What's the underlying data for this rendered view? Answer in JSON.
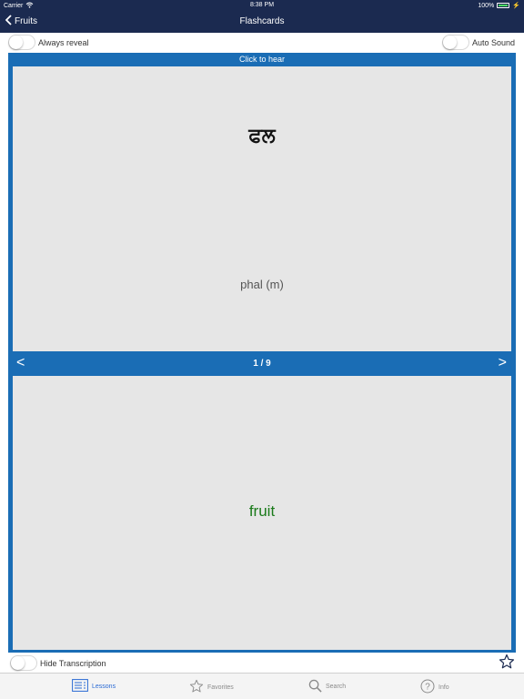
{
  "status_bar": {
    "carrier": "Carrier",
    "time": "8:38 PM",
    "battery": "100%",
    "icons": [
      "wifi-icon",
      "battery-icon",
      "charging-bolt-icon"
    ]
  },
  "nav_bar": {
    "back_label": "Fruits",
    "title": "Flashcards",
    "icons": [
      "chevron-left-icon"
    ]
  },
  "options": {
    "always_reveal_label": "Always reveal",
    "always_reveal_on": false,
    "auto_sound_label": "Auto Sound",
    "auto_sound_on": false
  },
  "card": {
    "hear_label": "Click to hear",
    "word": "ਫਲ",
    "transcription": "phal (m)",
    "prev_label": "<",
    "counter": "1 / 9",
    "next_label": ">",
    "translation": "fruit"
  },
  "bottom": {
    "hide_transcription_label": "Hide Transcription",
    "hide_transcription_on": false,
    "icons": [
      "star-outline-icon"
    ]
  },
  "tabs": [
    {
      "label": "Lessons",
      "icon": "lessons-list-icon",
      "active": true
    },
    {
      "label": "Favorites",
      "icon": "star-outline-icon",
      "active": false
    },
    {
      "label": "Search",
      "icon": "search-icon",
      "active": false
    },
    {
      "label": "Info",
      "icon": "question-circle-icon",
      "active": false
    }
  ],
  "colors": {
    "nav_bar": "#1b2a50",
    "card_frame": "#1a6db5",
    "card_bg": "#e6e6e6",
    "translation_text": "#1a7a1a",
    "tab_active": "#2a6ad4",
    "tab_inactive": "#8a8a8a",
    "battery_fill": "#4cd964"
  }
}
